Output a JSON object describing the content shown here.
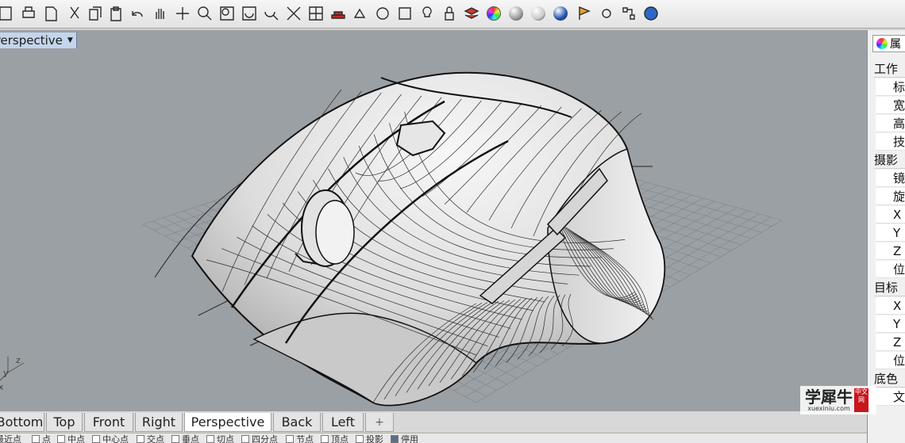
{
  "toolbar": {
    "icons": [
      "save-icon",
      "print-icon",
      "new-icon",
      "cut-icon",
      "copy-icon",
      "paste-icon",
      "undo-icon",
      "pan-hand-icon",
      "rotate-view-icon",
      "zoom-icon",
      "zoom-window-icon",
      "zoom-extents-icon",
      "zoom-selected-icon",
      "view-settings-icon",
      "four-viewports-icon",
      "car-icon",
      "shapes-icon",
      "circle-object-icon",
      "properties-icon",
      "light-icon",
      "lock-icon",
      "layer-icon",
      "color-wheel-icon",
      "shaded-sphere-icon",
      "rendered-sphere-icon",
      "blue-sphere-icon",
      "flag-icon",
      "settings-gear-icon",
      "grid-snap-icon",
      "help-icon"
    ]
  },
  "viewport": {
    "title": "Perspective",
    "axis_labels": {
      "x": "x",
      "y": "y",
      "z": "z"
    }
  },
  "tabs": [
    {
      "label": "Bottom",
      "active": false
    },
    {
      "label": "Top",
      "active": false
    },
    {
      "label": "Front",
      "active": false
    },
    {
      "label": "Right",
      "active": false
    },
    {
      "label": "Perspective",
      "active": true
    },
    {
      "label": "Back",
      "active": false
    },
    {
      "label": "Left",
      "active": false
    },
    {
      "label": "+",
      "active": false
    }
  ],
  "statusbar": {
    "snaps": [
      "最近点",
      "点",
      "中点",
      "中心点",
      "交点",
      "垂点",
      "切点",
      "四分点",
      "节点",
      "顶点",
      "投影",
      "停用"
    ]
  },
  "panel": {
    "tab_label": "属",
    "rows": [
      {
        "text": "工作",
        "type": "grp"
      },
      {
        "text": "标",
        "type": "sub"
      },
      {
        "text": "宽",
        "type": "sub"
      },
      {
        "text": "高",
        "type": "sub"
      },
      {
        "text": "技",
        "type": "sub"
      },
      {
        "text": "摄影",
        "type": "grp"
      },
      {
        "text": "镜",
        "type": "sub"
      },
      {
        "text": "旋",
        "type": "sub"
      },
      {
        "text": "X",
        "type": "sub"
      },
      {
        "text": "Y",
        "type": "sub"
      },
      {
        "text": "Z",
        "type": "sub"
      },
      {
        "text": "位",
        "type": "sub"
      },
      {
        "text": "目标",
        "type": "grp"
      },
      {
        "text": "X",
        "type": "sub"
      },
      {
        "text": "Y",
        "type": "sub"
      },
      {
        "text": "Z",
        "type": "sub"
      },
      {
        "text": "位",
        "type": "sub"
      },
      {
        "text": "底色",
        "type": "grp"
      },
      {
        "text": "文",
        "type": "sub"
      }
    ]
  },
  "watermark": {
    "main": "学犀牛",
    "url": "xuexiniu.com",
    "seal": "中文网"
  }
}
